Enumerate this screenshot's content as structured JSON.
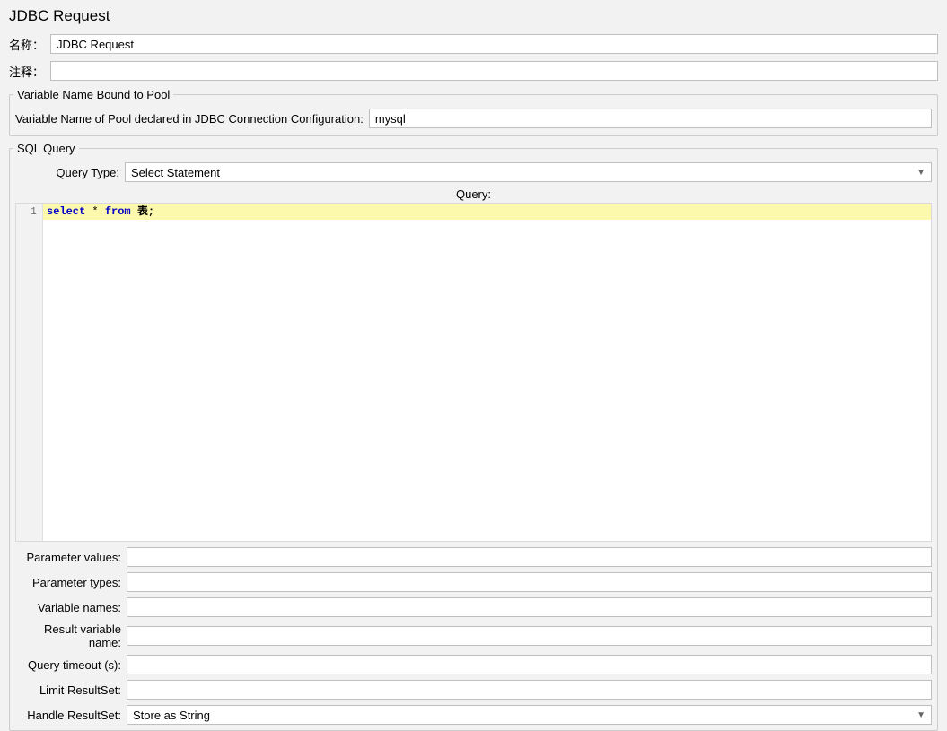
{
  "title": "JDBC Request",
  "name": {
    "label": "名称：",
    "value": "JDBC Request"
  },
  "comment": {
    "label": "注释：",
    "value": ""
  },
  "pool": {
    "legend": "Variable Name Bound to Pool",
    "label": "Variable Name of Pool declared in JDBC Connection Configuration:",
    "value": "mysql"
  },
  "sql": {
    "legend": "SQL Query",
    "queryTypeLabel": "Query Type:",
    "queryTypeValue": "Select Statement",
    "queryLabel": "Query:",
    "lineNumber": "1",
    "code": {
      "kw1": "select",
      "star": "*",
      "kw2": "from",
      "tail": " 表;"
    }
  },
  "fields": {
    "paramValues": {
      "label": "Parameter values:",
      "value": ""
    },
    "paramTypes": {
      "label": "Parameter types:",
      "value": ""
    },
    "varNames": {
      "label": "Variable names:",
      "value": ""
    },
    "resultVar": {
      "label": "Result variable name:",
      "value": ""
    },
    "timeout": {
      "label": "Query timeout (s):",
      "value": ""
    },
    "limit": {
      "label": "Limit ResultSet:",
      "value": ""
    },
    "handle": {
      "label": "Handle ResultSet:",
      "value": "Store as String"
    }
  }
}
